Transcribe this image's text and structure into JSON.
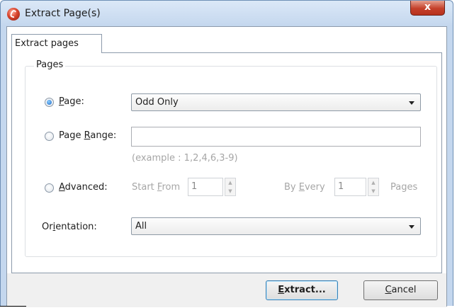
{
  "window": {
    "title": "Extract Page(s)",
    "close_label": "x",
    "colors": {
      "frame": "#c4d7ee",
      "close": "#c4402a",
      "radio_dot": "#1866c8"
    }
  },
  "tabs": [
    {
      "label": "Extract pages",
      "active": true
    }
  ],
  "group": {
    "label": "Pages"
  },
  "page_option": {
    "label_pre": "",
    "label_u": "P",
    "label_post": "age:",
    "selected": true,
    "dropdown_value": "Odd Only"
  },
  "range_option": {
    "label_pre": "Page ",
    "label_u": "R",
    "label_post": "ange:",
    "selected": false,
    "input_value": "",
    "example": "(example : 1,2,4,6,3-9)"
  },
  "advanced_option": {
    "label_pre": "",
    "label_u": "A",
    "label_post": "dvanced:",
    "selected": false,
    "start_from_pre": "Start ",
    "start_from_u": "F",
    "start_from_post": "rom",
    "start_value": "1",
    "by_every_pre": "By ",
    "by_every_u": "E",
    "by_every_post": "very",
    "every_value": "1",
    "pages_label": "Pages"
  },
  "orientation": {
    "label_pre": "Or",
    "label_u": "i",
    "label_post": "entation:",
    "dropdown_value": "All"
  },
  "buttons": {
    "extract_pre": "",
    "extract_u": "E",
    "extract_post": "xtract...",
    "cancel_pre": "",
    "cancel_u": "C",
    "cancel_post": "ancel"
  }
}
